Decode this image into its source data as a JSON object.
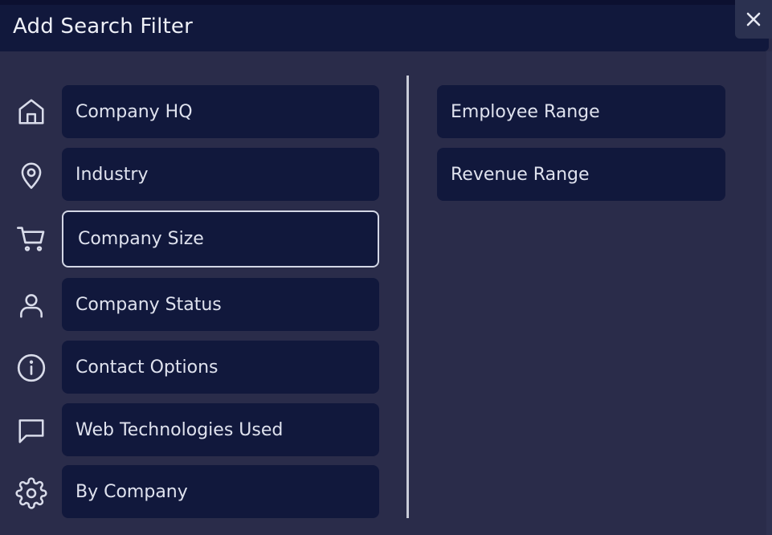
{
  "dialog": {
    "title": "Add Search Filter"
  },
  "left_options": [
    {
      "label": "Company HQ",
      "icon": "home-icon"
    },
    {
      "label": "Industry",
      "icon": "map-pin-icon"
    },
    {
      "label": "Company Size",
      "icon": "shopping-cart-icon",
      "selected": true
    },
    {
      "label": "Company Status",
      "icon": "user-icon"
    },
    {
      "label": "Contact Options",
      "icon": "info-icon"
    },
    {
      "label": "Web Technologies Used",
      "icon": "message-square-icon"
    },
    {
      "label": "By Company",
      "icon": "gear-icon"
    }
  ],
  "right_options": [
    {
      "label": "Employee Range"
    },
    {
      "label": "Revenue Range"
    }
  ],
  "colors": {
    "background": "#2a2c4a",
    "header": "#11183c",
    "option_bg": "#11183c",
    "text": "#dfe2ee",
    "selected_border": "#d3d7e6"
  }
}
